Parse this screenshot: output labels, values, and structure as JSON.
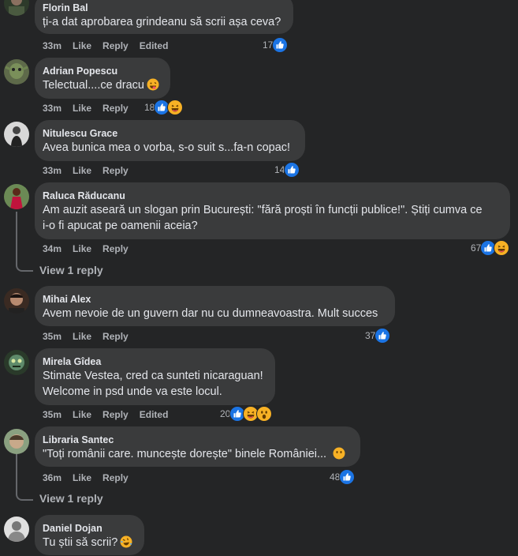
{
  "actions": {
    "like": "Like",
    "reply": "Reply",
    "edited": "Edited"
  },
  "comments": [
    {
      "author": "Florin Bal",
      "text": "ți-a dat aprobarea grindeanu să scrii așa ceva?",
      "time": "33m",
      "edited": true,
      "count": "17"
    },
    {
      "author": "Adrian Popescu",
      "text": "Telectual....ce dracu",
      "time": "33m",
      "edited": false,
      "count": "18",
      "emoji": "grinning-tongue"
    },
    {
      "author": "Nitulescu Grace",
      "text": "Avea bunica mea o vorba, s-o suit s...fa-n copac!",
      "time": "33m",
      "edited": false,
      "count": "14"
    },
    {
      "author": "Raluca Răducanu",
      "text1": "Am auzit aseară un slogan prin București: \"fără proști în funcții publice!\". Știți cumva ce",
      "text2": "i-o fi apucat pe oamenii aceia?",
      "time": "34m",
      "edited": false,
      "count": "67",
      "reply_link": "View 1 reply"
    },
    {
      "author": "Mihai Alex",
      "text": "Avem nevoie de un guvern dar nu cu dumneavoastra. Mult succes",
      "time": "35m",
      "edited": false,
      "count": "37"
    },
    {
      "author": "Mirela Gîdea",
      "text1": "Stimate Vestea, cred ca sunteti nicaraguan!",
      "text2": "Welcome in psd unde va este locul.",
      "time": "35m",
      "edited": true,
      "count": "20"
    },
    {
      "author": "Libraria Santec",
      "text": "\"Toți românii care. muncește dorește\" binele României...",
      "time": "36m",
      "edited": false,
      "count": "48",
      "reply_link": "View 1 reply"
    },
    {
      "author": "Daniel Dojan",
      "text": "Tu știi să scrii?"
    }
  ]
}
